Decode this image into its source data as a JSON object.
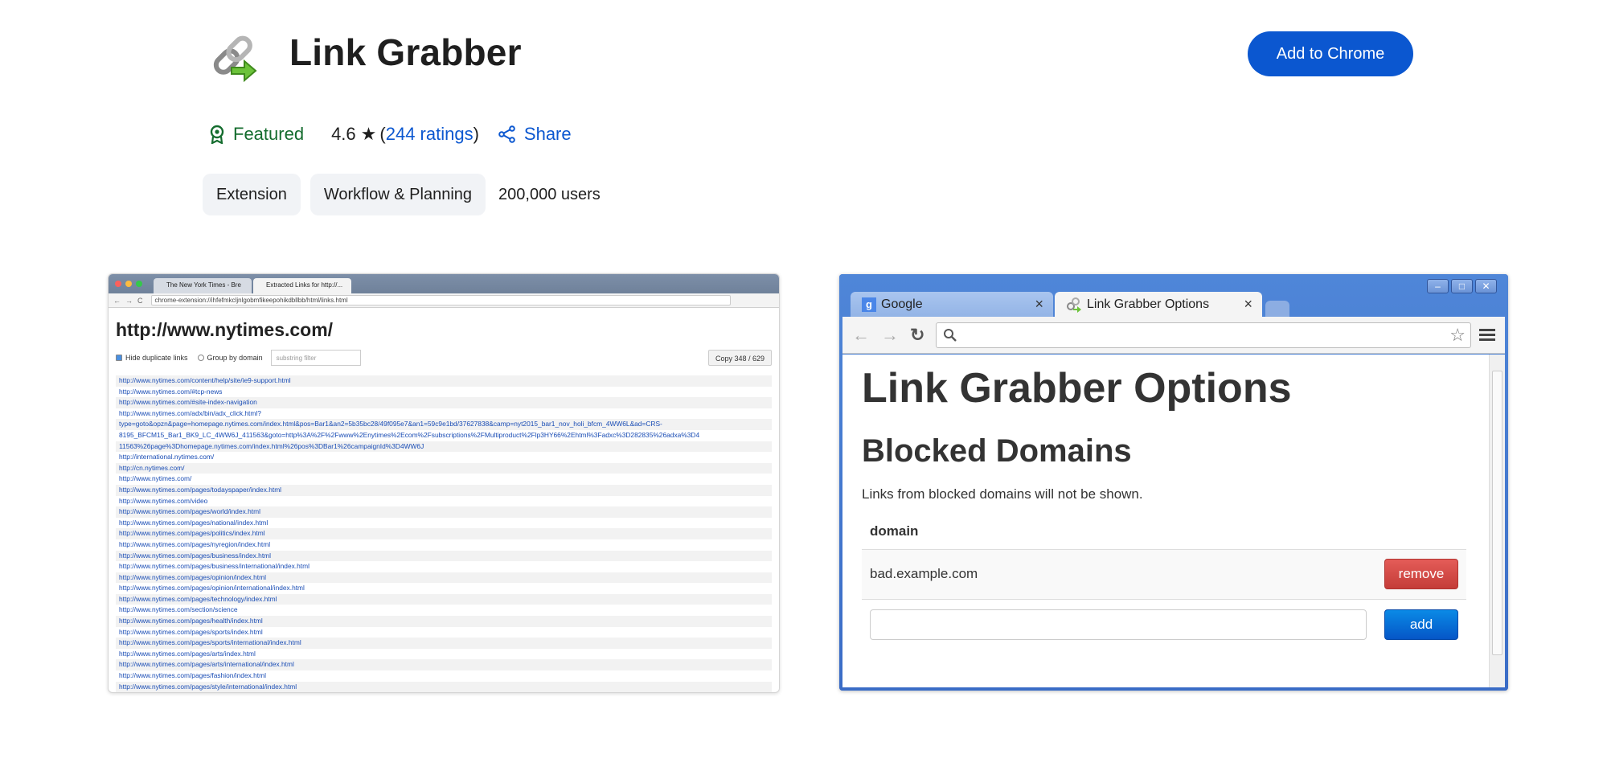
{
  "header": {
    "title": "Link Grabber",
    "add_button": "Add to Chrome",
    "icon": "chain-link-arrow-icon"
  },
  "meta": {
    "featured": "Featured",
    "rating": "4.6",
    "rating_open": "(",
    "ratings_link": "244 ratings",
    "rating_close": ")",
    "share": "Share"
  },
  "chips": {
    "extension": "Extension",
    "category": "Workflow & Planning",
    "users": "200,000 users"
  },
  "colors": {
    "accent": "#0b57d0",
    "featured": "#146c2e",
    "remove": "#d9534f",
    "add": "#0a6fd8"
  },
  "screenshot1": {
    "tab1": "The New York Times - Bre",
    "tab2": "Extracted Links for http://...",
    "url": "chrome-extension://ihfefmkcljnlgobmfikeepohikdbllbb/html/links.html",
    "heading": "http://www.nytimes.com/",
    "hide_duplicates": "Hide duplicate links",
    "group_by_domain": "Group by domain",
    "filter_placeholder": "substring filter",
    "copy_button": "Copy 348 / 629",
    "links": [
      "http://www.nytimes.com/content/help/site/ie9-support.html",
      "http://www.nytimes.com/#tcp-news",
      "http://www.nytimes.com/#site-index-navigation",
      "http://www.nytimes.com/adx/bin/adx_click.html?",
      "type=goto&opzn&page=homepage.nytimes.com/index.html&pos=Bar1&an2=5b35bc28/49f095e7&an1=59c9e1bd/37627838&camp=nyt2015_bar1_nov_holi_bfcm_4WW6L&ad=CRS-",
      "8195_BFCM15_Bar1_BK9_LC_4WW6J_411563&goto=http%3A%2F%2Fwww%2Enytimes%2Ecom%2Fsubscriptions%2FMultiproduct%2Flp3HY66%2Ehtml%3Fadxc%3D282835%26adxa%3D4",
      "11563%26page%3Dhomepage.nytimes.com/index.html%26pos%3DBar1%26campaignId%3D4WW6J",
      "http://international.nytimes.com/",
      "http://cn.nytimes.com/",
      "http://www.nytimes.com/",
      "http://www.nytimes.com/pages/todayspaper/index.html",
      "http://www.nytimes.com/video",
      "http://www.nytimes.com/pages/world/index.html",
      "http://www.nytimes.com/pages/national/index.html",
      "http://www.nytimes.com/pages/politics/index.html",
      "http://www.nytimes.com/pages/nyregion/index.html",
      "http://www.nytimes.com/pages/business/index.html",
      "http://www.nytimes.com/pages/business/international/index.html",
      "http://www.nytimes.com/pages/opinion/index.html",
      "http://www.nytimes.com/pages/opinion/international/index.html",
      "http://www.nytimes.com/pages/technology/index.html",
      "http://www.nytimes.com/section/science",
      "http://www.nytimes.com/pages/health/index.html",
      "http://www.nytimes.com/pages/sports/index.html",
      "http://www.nytimes.com/pages/sports/international/index.html",
      "http://www.nytimes.com/pages/arts/index.html",
      "http://www.nytimes.com/pages/arts/international/index.html",
      "http://www.nytimes.com/pages/fashion/index.html",
      "http://www.nytimes.com/pages/style/international/index.html"
    ]
  },
  "screenshot2": {
    "tab_google": "Google",
    "tab_options": "Link Grabber Options",
    "heading": "Link Grabber Options",
    "subheading": "Blocked Domains",
    "description": "Links from blocked domains will not be shown.",
    "column_header": "domain",
    "blocked_domain": "bad.example.com",
    "remove_button": "remove",
    "add_button": "add"
  }
}
